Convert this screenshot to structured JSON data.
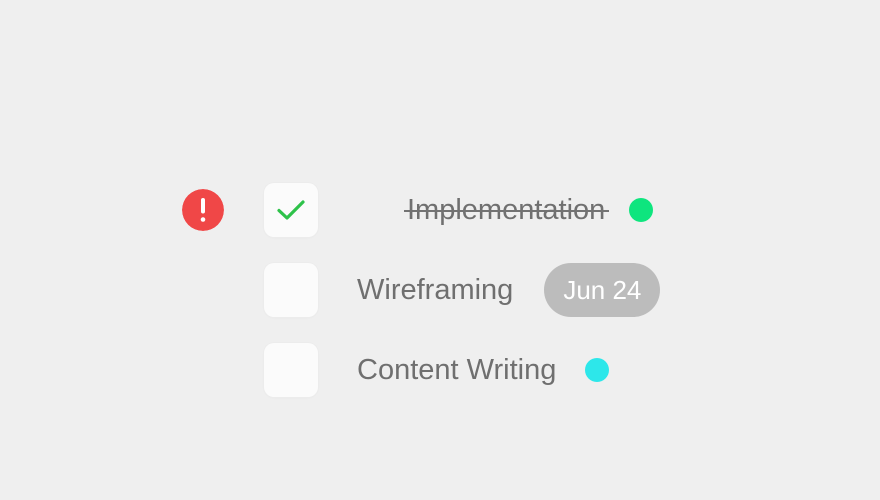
{
  "tasks": [
    {
      "label": "Implementation",
      "completed": true,
      "status_color": "#0ee57e"
    },
    {
      "label": "Wireframing",
      "completed": false,
      "due_date": "Jun 24"
    },
    {
      "label": "Content Writing",
      "completed": false,
      "status_color": "#2de7ea"
    }
  ],
  "alert": {
    "icon": "exclamation-icon",
    "color": "#f04747"
  },
  "colors": {
    "background": "#efefef",
    "checkmark": "#2ec24a",
    "text": "#6f6f6f",
    "date_pill": "#bcbcbc"
  }
}
